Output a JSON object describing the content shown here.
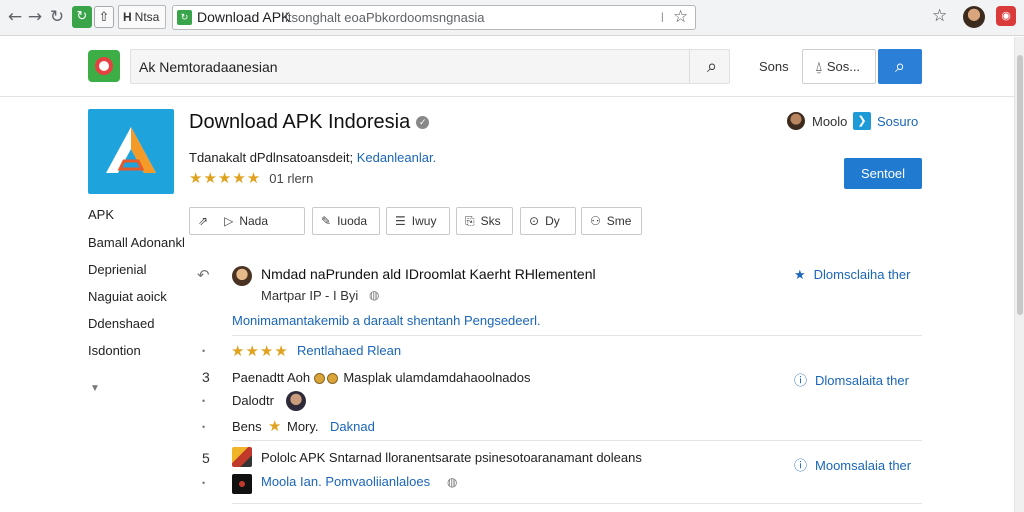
{
  "browser": {
    "tab_label": "Ntsa",
    "tab_title": "Download APK",
    "url_rest": "ltsonghalt eoaPbkordoomsngnasia",
    "icons": [
      "back-arrow-icon",
      "forward-arrow-icon",
      "reload-icon",
      "bookmark-star-icon"
    ]
  },
  "site": {
    "search_text": "Ak Nemtoradaanesian",
    "header_link": "Sons",
    "header_button": "Sos...",
    "accent": "#2b7fd6"
  },
  "app": {
    "title": "Download APK Indoresia",
    "subtitle": "Tdanakalt dPdlnsatoansdeit;",
    "subtitle_link": "Kedanleanlar.",
    "stars": "★★★★★",
    "rating_count": "01 rlern",
    "developer_name": "Moolo",
    "developer_link": "Sosuro",
    "install_label": "Sentoel",
    "icon_colors": {
      "bg": "#1ea3dc",
      "left": "#ffffff",
      "right": "#f39a28"
    }
  },
  "sidebar": {
    "items": [
      "APK",
      "Bamall Adonankl",
      "Deprienial",
      "Naguiat aoick",
      "Ddenshaed",
      "Isdontion"
    ]
  },
  "tools": [
    {
      "icon": "share-icon",
      "glyph": "⇗",
      "label": ""
    },
    {
      "icon": "send-icon",
      "glyph": "▷",
      "label": "Nada"
    },
    {
      "icon": "edit-icon",
      "glyph": "✎",
      "label": "Iuoda"
    },
    {
      "icon": "list-icon",
      "glyph": "☰",
      "label": "Iwuy"
    },
    {
      "icon": "save-icon",
      "glyph": "⎘",
      "label": "Sks"
    },
    {
      "icon": "location-icon",
      "glyph": "⊙",
      "label": "Dy"
    },
    {
      "icon": "person-icon",
      "glyph": "⚇",
      "label": "Sme"
    }
  ],
  "reviews": [
    {
      "title": "Nmdad naPrunden ald IDroomlat Kaerht RHlementenl",
      "meta": "Martpar IP - I Byi",
      "body": "Monimamantakemib a daraalt shentanh Pengsedeerl.",
      "action": "Dlomsclaiha ther"
    },
    {
      "stars": "★★★★",
      "link": "Rentlahaed Rlean"
    },
    {
      "num": "3",
      "text": "Paenadtt Aoh",
      "text2": "Masplak ulamdamdahaoolnados",
      "action": "Dlomsalaita ther"
    },
    {
      "label": "Dalodtr"
    },
    {
      "label1": "Bens",
      "label2": "Mory.",
      "link": "Daknad"
    },
    {
      "num": "5",
      "text": "Pololc APK Sntarnad lloranentsarate psinesotoaranamant doleans",
      "action": "Moomsalaia ther"
    },
    {
      "link": "Moola Ian. Pomvaoliianlaloes"
    }
  ]
}
